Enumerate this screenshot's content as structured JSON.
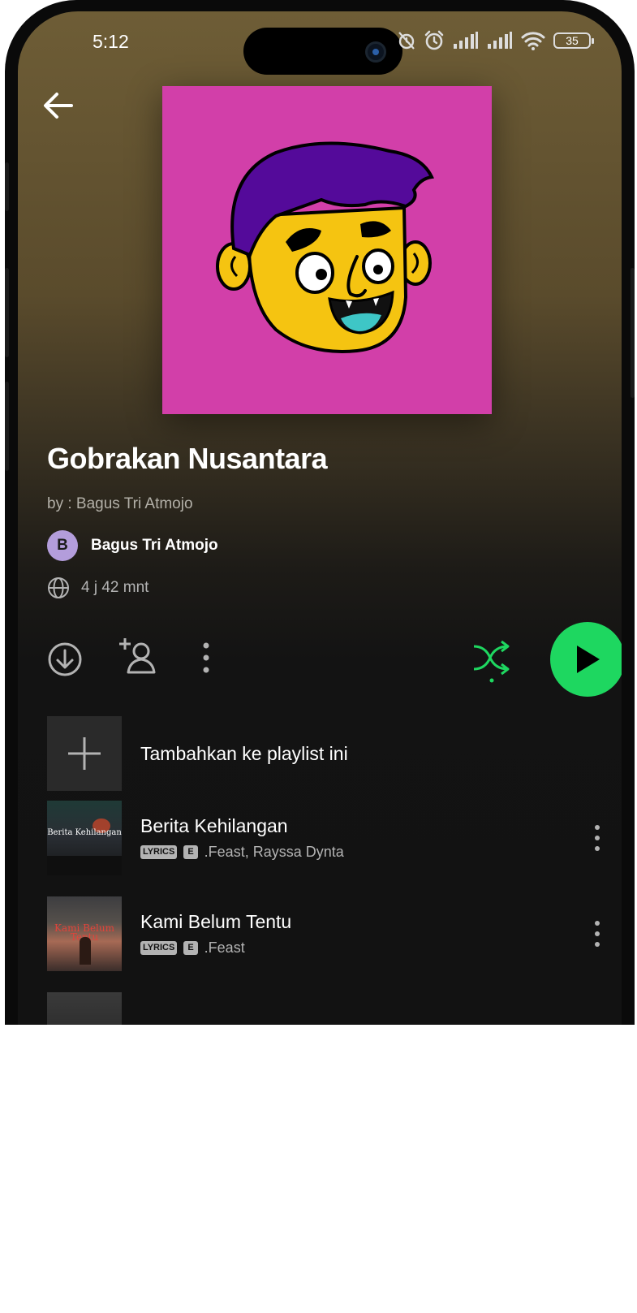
{
  "status_bar": {
    "time": "5:12",
    "battery": "35"
  },
  "playlist": {
    "title": "Gobrakan Nusantara",
    "description": "by : Bagus Tri Atmojo",
    "owner_initial": "B",
    "owner_name": "Bagus Tri Atmojo",
    "duration": "4 j 42 mnt"
  },
  "icons": {
    "back": "arrow-left-icon",
    "download": "download-circle-icon",
    "add_user": "add-person-icon",
    "more": "more-vertical-icon",
    "shuffle": "shuffle-icon",
    "play": "play-icon",
    "globe": "globe-icon",
    "plus": "plus-icon"
  },
  "colors": {
    "accent": "#1ed760",
    "cover_bg": "#d23fa9",
    "background": "#121212"
  },
  "add_to_playlist_label": "Tambahkan ke playlist ini",
  "tracks": [
    {
      "title": "Berita Kehilangan",
      "badge_lyrics": "LYRICS",
      "badge_explicit": "E",
      "artists": ".Feast, Rayssa Dynta",
      "art_text": "Berita Kehilangan"
    },
    {
      "title": "Kami Belum Tentu",
      "badge_lyrics": "LYRICS",
      "badge_explicit": "E",
      "artists": ".Feast",
      "art_text": "Kami Belum Tentu"
    }
  ]
}
